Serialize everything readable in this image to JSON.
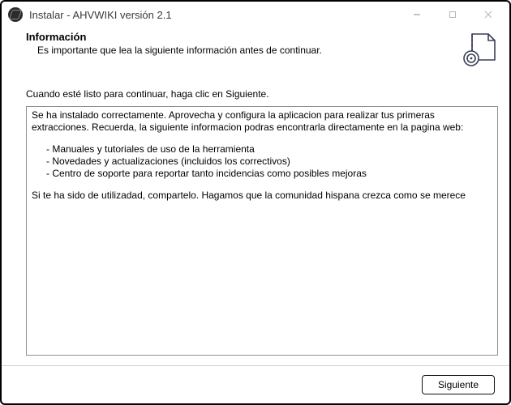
{
  "window": {
    "title": "Instalar - AHVWIKI versión 2.1"
  },
  "header": {
    "heading": "Información",
    "subheading": "Es importante que lea la siguiente información antes de continuar."
  },
  "body": {
    "prompt": "Cuando esté listo para continuar, haga clic en Siguiente.",
    "info_paragraph_1": "Se ha instalado correctamente. Aprovecha y configura la aplicacion para realizar tus primeras extracciones. Recuerda, la siguiente informacion podras encontrarla directamente en la pagina web:",
    "info_bullets": [
      "Manuales y tutoriales de uso de la herramienta",
      "Novedades y actualizaciones (incluidos los correctivos)",
      "Centro de soporte para reportar tanto incidencias como posibles mejoras"
    ],
    "info_paragraph_2": "Si te ha sido de utilizadad, compartelo. Hagamos que la comunidad hispana crezca como se merece"
  },
  "footer": {
    "next_label": "Siguiente"
  }
}
